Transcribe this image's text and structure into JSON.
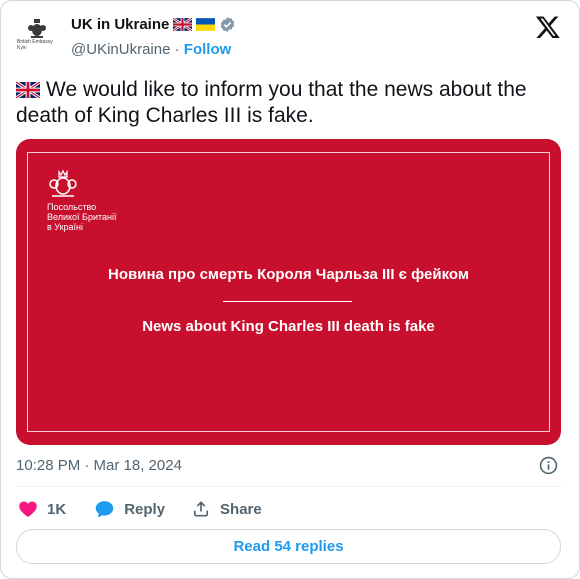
{
  "author": {
    "name": "UK in Ukraine",
    "handle": "@UKinUkraine",
    "separator": "·",
    "follow_label": "Follow",
    "avatar_caption": [
      "British Embassy",
      "Kyiv"
    ],
    "icons": [
      "uk-flag-icon",
      "ukraine-flag-icon",
      "verified-badge-icon",
      "x-logo-icon"
    ]
  },
  "tweet": {
    "text": "We would like to inform you that the news about the death of King Charles III is fake."
  },
  "media": {
    "embassy_lines": [
      "Посольство",
      "Великої Британії",
      "в Україні"
    ],
    "headline_ua": "Новина про смерть Короля Чарльза ІІІ є фейком",
    "headline_en": "News about King Charles III death is fake",
    "background_color": "#c8102e"
  },
  "meta": {
    "timestamp": "10:28 PM · Mar 18, 2024"
  },
  "actions": {
    "likes_count": "1K",
    "reply_label": "Reply",
    "share_label": "Share"
  },
  "replies_button": {
    "label": "Read 54 replies"
  },
  "colors": {
    "accent": "#1d9bf0",
    "like": "#f91880",
    "muted": "#536471"
  }
}
